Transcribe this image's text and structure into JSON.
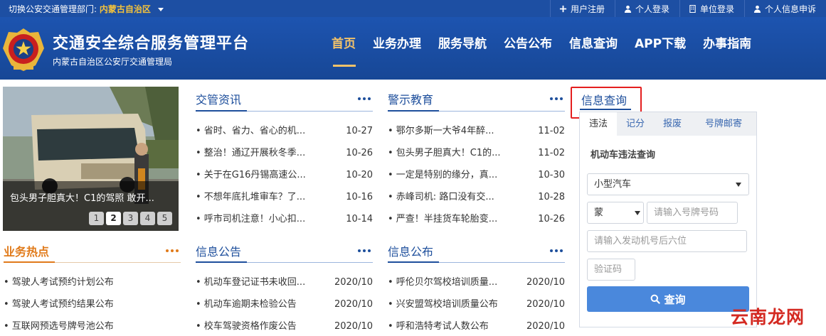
{
  "topbar": {
    "dept_label": "切换公安交通管理部门:",
    "dept_value": "内蒙古自治区",
    "links": [
      {
        "label": "用户注册",
        "icon": "plus-icon"
      },
      {
        "label": "个人登录",
        "icon": "user-icon"
      },
      {
        "label": "单位登录",
        "icon": "building-icon"
      },
      {
        "label": "个人信息申诉",
        "icon": "user-icon"
      }
    ]
  },
  "header": {
    "title": "交通安全综合服务管理平台",
    "subtitle": "内蒙古自治区公安厅交通管理局",
    "nav": [
      "首页",
      "业务办理",
      "服务导航",
      "公告公布",
      "信息查询",
      "APP下载",
      "办事指南"
    ]
  },
  "slider": {
    "caption": "包头男子胆真大！C1的驾照 敢开...",
    "pages": [
      "1",
      "2",
      "3",
      "4",
      "5"
    ],
    "current": "2"
  },
  "news": {
    "title": "交管资讯",
    "items": [
      {
        "text": "• 省时、省力、省心的机...",
        "date": "10-27"
      },
      {
        "text": "• 整治！通辽开展秋冬季...",
        "date": "10-26"
      },
      {
        "text": "• 关于在G16丹锡高速公...",
        "date": "10-20"
      },
      {
        "text": "• 不想年底扎堆审车？了...",
        "date": "10-16"
      },
      {
        "text": "• 呼市司机注意！小心扣...",
        "date": "10-14"
      }
    ]
  },
  "warning": {
    "title": "警示教育",
    "items": [
      {
        "text": "• 鄂尔多斯一大爷4年醉...",
        "date": "11-02"
      },
      {
        "text": "• 包头男子胆真大！C1的...",
        "date": "11-02"
      },
      {
        "text": "• 一定是特别的缘分，真...",
        "date": "10-30"
      },
      {
        "text": "• 赤峰司机: 路口没有交...",
        "date": "10-28"
      },
      {
        "text": "• 严查！半挂货车轮胎变...",
        "date": "10-26"
      }
    ]
  },
  "hot": {
    "title": "业务热点",
    "items": [
      {
        "text": "• 驾驶人考试预约计划公布"
      },
      {
        "text": "• 驾驶人考试预约结果公布"
      },
      {
        "text": "• 互联网预选号牌号池公布"
      }
    ]
  },
  "notice": {
    "title": "信息公告",
    "items": [
      {
        "text": "• 机动车登记证书未收回...",
        "date": "2020/10"
      },
      {
        "text": "• 机动车逾期未检验公告",
        "date": "2020/10"
      },
      {
        "text": "• 校车驾驶资格作废公告",
        "date": "2020/10"
      }
    ]
  },
  "publish": {
    "title": "信息公布",
    "items": [
      {
        "text": "• 呼伦贝尔驾校培训质量...",
        "date": "2020/10"
      },
      {
        "text": "• 兴安盟驾校培训质量公布",
        "date": "2020/10"
      },
      {
        "text": "• 呼和浩特考试人数公布",
        "date": "2020/10"
      }
    ]
  },
  "query": {
    "title": "信息查询",
    "tabs": [
      "违法",
      "记分",
      "报废",
      "号牌邮寄"
    ],
    "active_tab": "违法",
    "subtitle": "机动车违法查询",
    "vehicle_type": "小型汽车",
    "province": "蒙",
    "plate_placeholder": "请输入号牌号码",
    "engine_placeholder": "请输入发动机号后六位",
    "captcha_placeholder": "验证码",
    "submit_label": "查询"
  },
  "watermark": "云南龙网",
  "colors": {
    "brand_blue": "#1d4fa3",
    "nav_active": "#f2c26a",
    "hot_orange": "#e07a1a",
    "highlight_red": "#e41f1f",
    "button_blue": "#4a88dc"
  }
}
